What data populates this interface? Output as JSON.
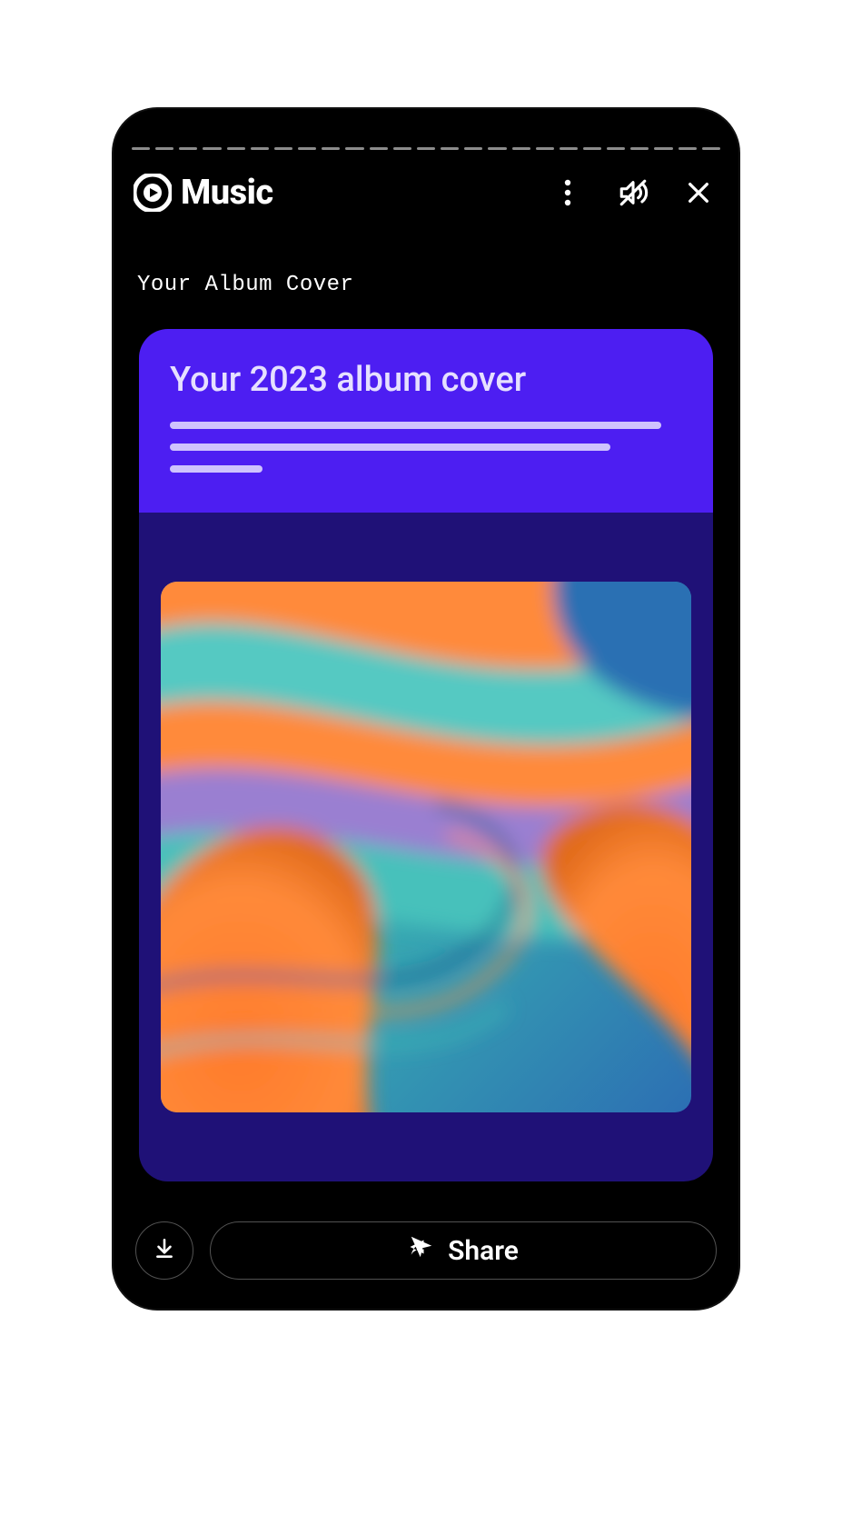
{
  "app_name": "Music",
  "story_subtitle": "Your Album Cover",
  "card": {
    "title": "Your 2023 album cover"
  },
  "actions": {
    "share_label": "Share"
  },
  "progress_segments": 25
}
